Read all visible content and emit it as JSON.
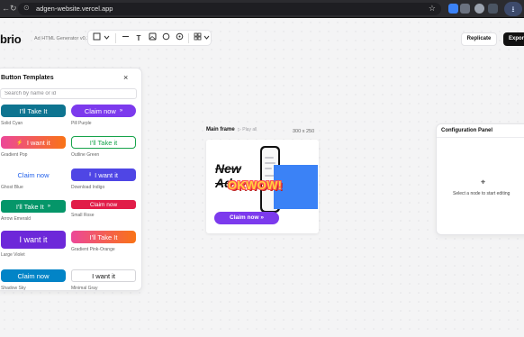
{
  "browser": {
    "url": "adgen-website.vercel.app",
    "back_glyph": "←",
    "reload_glyph": "↻",
    "secure_glyph": "⊙",
    "star_glyph": "☆",
    "download_glyph": "⭳"
  },
  "app": {
    "brand": "brio",
    "version": "Ad HTML Generator v0.1",
    "toolbar_icons": [
      "frame-icon",
      "chevron-down-icon",
      "rectangle-icon",
      "text-icon",
      "image-icon",
      "circle-icon",
      "settings-icon",
      "grid-icon"
    ],
    "replicate_label": "Replicate",
    "export_label": "Export"
  },
  "templates_panel": {
    "title": "Button Templates",
    "close_glyph": "×",
    "search_placeholder": "Search by name or id",
    "items": [
      {
        "label": "I'll Take It",
        "name": "Solid Cyan",
        "icon": "",
        "bg": "#0e7490",
        "fg": "#ffffff"
      },
      {
        "label": "Claim now",
        "name": "Pill Purple",
        "icon": "»",
        "bg": "#7c3aed",
        "fg": "#ffffff"
      },
      {
        "label": "I want it",
        "name": "Gradient Pop",
        "icon": "⚡",
        "bg": "#ec4899",
        "fg": "#ffffff"
      },
      {
        "label": "I'll Take it",
        "name": "Outline Green",
        "icon": "",
        "bg": "#ffffff",
        "fg": "#16a34a"
      },
      {
        "label": "Claim now",
        "name": "Ghost Blue",
        "icon": "",
        "bg": "#ffffff",
        "fg": "#2563eb"
      },
      {
        "label": "I want it",
        "name": "Download Indigo",
        "icon": "⭳",
        "bg": "#4f46e5",
        "fg": "#ffffff"
      },
      {
        "label": "I'll Take It",
        "name": "Arrow Emerald",
        "icon": "»",
        "bg": "#059669",
        "fg": "#ffffff"
      },
      {
        "label": "Claim now",
        "name": "Small Rose",
        "icon": "",
        "bg": "#e11d48",
        "fg": "#ffffff"
      },
      {
        "label": "I want it",
        "name": "Large Violet",
        "icon": "",
        "bg": "#6d28d9",
        "fg": "#ffffff"
      },
      {
        "label": "I'll Take It",
        "name": "Gradient Pink-Orange",
        "icon": "",
        "bg": "#ec4899",
        "fg": "#ffffff"
      },
      {
        "label": "Claim now",
        "name": "Shadow Sky",
        "icon": "",
        "bg": "#0284c7",
        "fg": "#ffffff"
      },
      {
        "label": "I want it",
        "name": "Minimal Gray",
        "icon": "",
        "bg": "#ffffff",
        "fg": "#111111"
      }
    ]
  },
  "main_frame": {
    "label": "Main frame",
    "play_label": "▷ Play all",
    "size": "300 x 250",
    "headline_line1": "New",
    "headline_line2": "Ad",
    "sticker_text": "OKWOW!",
    "cta_label": "Claim now",
    "cta_icon": "»",
    "accent_blue": "#3b82f6",
    "accent_purple": "#7c3aed"
  },
  "config_panel": {
    "title": "Configuration Panel",
    "icon_glyph": "⌖",
    "empty_message": "Select a node to start editing"
  }
}
